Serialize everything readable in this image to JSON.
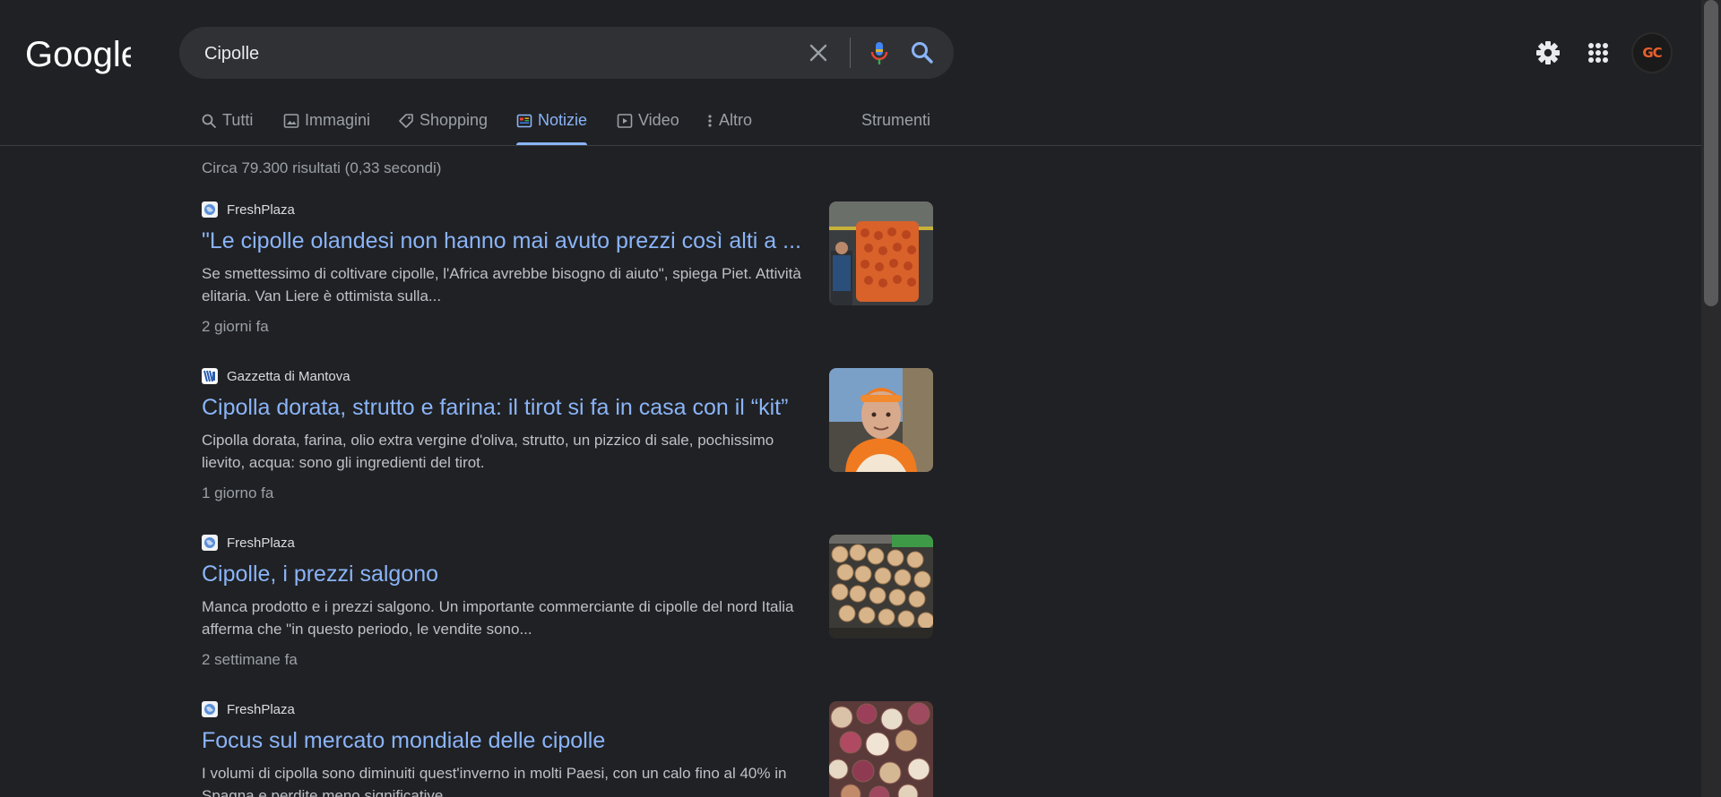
{
  "brand": {
    "logo_text": "Google"
  },
  "search": {
    "query": "Cipolle"
  },
  "user": {
    "avatar_initials": "GC"
  },
  "tabs": [
    {
      "label": "Tutti",
      "icon": "search-icon",
      "active": false
    },
    {
      "label": "Immagini",
      "icon": "image-icon",
      "active": false
    },
    {
      "label": "Shopping",
      "icon": "tag-icon",
      "active": false
    },
    {
      "label": "Notizie",
      "icon": "news-icon",
      "active": true
    },
    {
      "label": "Video",
      "icon": "play-icon",
      "active": false
    },
    {
      "label": "Altro",
      "icon": "more-vert-icon",
      "active": false
    }
  ],
  "tools_label": "Strumenti",
  "result_stats": "Circa 79.300 risultati (0,33 secondi)",
  "results": [
    {
      "source": "FreshPlaza",
      "title": "\"Le cipolle olandesi non hanno mai avuto prezzi così alti a ...",
      "snippet": "Se smettessimo di coltivare cipolle, l'Africa avrebbe bisogno di aiuto\", spiega Piet. Attività elitaria. Van Liere è ottimista sulla...",
      "date": "2 giorni fa",
      "thumb": "onion-sacks-photo"
    },
    {
      "source": "Gazzetta di Mantova",
      "title": "Cipolla dorata, strutto e farina: il tirot si fa in casa con il “kit”",
      "snippet": "Cipolla dorata, farina, olio extra vergine d'oliva, strutto, un pizzico di sale, pochissimo lievito, acqua: sono gli ingredienti del tirot.",
      "date": "1 giorno fa",
      "thumb": "man-portrait-photo"
    },
    {
      "source": "FreshPlaza",
      "title": "Cipolle, i prezzi salgono",
      "snippet": "Manca prodotto e i prezzi salgono. Un importante commerciante di cipolle del nord Italia afferma che \"in questo periodo, le vendite sono...",
      "date": "2 settimane fa",
      "thumb": "onion-crates-photo"
    },
    {
      "source": "FreshPlaza",
      "title": "Focus sul mercato mondiale delle cipolle",
      "snippet": "I volumi di cipolla sono diminuiti quest'inverno in molti Paesi, con un calo fino al 40% in Spagna e perdite meno significative...",
      "date": "",
      "thumb": "mixed-onions-photo"
    }
  ],
  "colors": {
    "background": "#202124",
    "link": "#8ab4f8",
    "text": "#bdc1c6",
    "muted": "#9aa0a6",
    "searchbar": "#303134"
  }
}
